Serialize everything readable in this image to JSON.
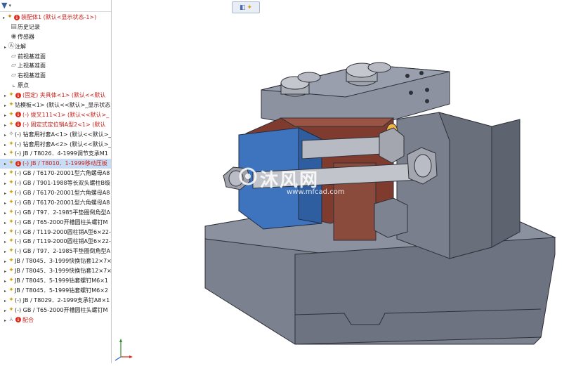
{
  "feature_tree": {
    "filter_icon": "funnel-icon",
    "items": [
      {
        "label": "装配体1 (默认<显示状态-1>)",
        "icon": "assembly-icon",
        "error": true,
        "red": true,
        "level": "root"
      },
      {
        "label": "历史记录",
        "icon": "history-icon",
        "error": false,
        "red": false,
        "level": "bare"
      },
      {
        "label": "传感器",
        "icon": "sensor-icon",
        "error": false,
        "red": false,
        "level": "bare"
      },
      {
        "label": "注解",
        "icon": "annotation-icon",
        "error": false,
        "red": false,
        "level": "child"
      },
      {
        "label": "前视基准面",
        "icon": "plane-icon",
        "error": false,
        "red": false,
        "level": "bare"
      },
      {
        "label": "上视基准面",
        "icon": "plane-icon",
        "error": false,
        "red": false,
        "level": "bare"
      },
      {
        "label": "右视基准面",
        "icon": "plane-icon",
        "error": false,
        "red": false,
        "level": "bare"
      },
      {
        "label": "原点",
        "icon": "origin-icon",
        "error": false,
        "red": false,
        "level": "bare"
      },
      {
        "label": "(固定) 夹具体<1> (默认<<默认",
        "icon": "part-icon",
        "error": true,
        "red": true,
        "level": "child"
      },
      {
        "label": "钻模板<1> (默认<<默认>_显示状态",
        "icon": "part-icon",
        "error": false,
        "red": false,
        "level": "child"
      },
      {
        "label": "(-) 拨叉111<1> (默认<<默认>_",
        "icon": "part-icon",
        "error": true,
        "red": true,
        "level": "child"
      },
      {
        "label": "(-) 固定式定位销A型2<1> (默认",
        "icon": "part-icon",
        "error": true,
        "red": true,
        "level": "child"
      },
      {
        "label": "(-) 钻套用衬套A<1> (默认<<默认>_",
        "icon": "part-warn-icon",
        "error": false,
        "red": false,
        "level": "child"
      },
      {
        "label": "(-) 钻套用衬套A<2> (默认<<默认>_",
        "icon": "part-icon",
        "error": false,
        "red": false,
        "level": "child"
      },
      {
        "label": "(-) JB / T8026．4-1999调节支承M1",
        "icon": "part-icon",
        "error": false,
        "red": false,
        "level": "child"
      },
      {
        "label": "(-) JB / T8010．1-1999移动压板",
        "icon": "part-icon",
        "error": true,
        "red": true,
        "level": "child",
        "selected": true
      },
      {
        "label": "(-) GB / T6170-20001型六角螺母A8",
        "icon": "part-icon",
        "error": false,
        "red": false,
        "level": "child"
      },
      {
        "label": "(-) GB / T901-1988等长双头螺柱B级",
        "icon": "part-icon",
        "error": false,
        "red": false,
        "level": "child"
      },
      {
        "label": "(-) GB / T6170-20001型六角螺母A8",
        "icon": "part-icon",
        "error": false,
        "red": false,
        "level": "child"
      },
      {
        "label": "(-) GB / T6170-20001型六角螺母A8",
        "icon": "part-icon",
        "error": false,
        "red": false,
        "level": "child"
      },
      {
        "label": "(-) GB / T97．2-1985平垫圈倒角型A",
        "icon": "part-icon",
        "error": false,
        "red": false,
        "level": "child"
      },
      {
        "label": "(-) GB / T65-2000开槽圆柱头螺钉M",
        "icon": "part-icon",
        "error": false,
        "red": false,
        "level": "child"
      },
      {
        "label": "(-) GB / T119-2000圆柱销A型6×22-",
        "icon": "part-icon",
        "error": false,
        "red": false,
        "level": "child"
      },
      {
        "label": "(-) GB / T119-2000圆柱销A型6×22-",
        "icon": "part-icon",
        "error": false,
        "red": false,
        "level": "child"
      },
      {
        "label": "(-) GB / T97．2-1985平垫圈倒角型A",
        "icon": "part-icon",
        "error": false,
        "red": false,
        "level": "child"
      },
      {
        "label": "JB / T8045．3-1999快换钻套12×7×",
        "icon": "part-icon",
        "error": false,
        "red": false,
        "level": "child"
      },
      {
        "label": "JB / T8045．3-1999快换钻套12×7×",
        "icon": "part-icon",
        "error": false,
        "red": false,
        "level": "child"
      },
      {
        "label": "JB / T8045．5-1999钻套螺钉M6×1",
        "icon": "part-icon",
        "error": false,
        "red": false,
        "level": "child"
      },
      {
        "label": "JB / T8045．5-1999钻套螺钉M6×2",
        "icon": "part-icon",
        "error": false,
        "red": false,
        "level": "child"
      },
      {
        "label": "(-) JB / T8029．2-1999支承钉A8×1",
        "icon": "part-icon",
        "error": false,
        "red": false,
        "level": "child"
      },
      {
        "label": "(-) GB / T65-2000开槽圆柱头螺钉M",
        "icon": "part-icon",
        "error": false,
        "red": false,
        "level": "child"
      },
      {
        "label": "配合",
        "icon": "mates-icon",
        "error": true,
        "red": true,
        "level": "child"
      }
    ]
  },
  "watermark": {
    "title": "沐风网",
    "url": "www.mfcad.com"
  },
  "view_toolbar": {
    "icons": [
      "view-orientation-icon",
      "assembly-display-icon"
    ]
  },
  "colors": {
    "error_red": "#d92c1c",
    "selection": "#c7dcf5",
    "model_gray": "#7e8392",
    "fixture_blue": "#3d74bd",
    "plate_brown": "#8a4a3c"
  }
}
